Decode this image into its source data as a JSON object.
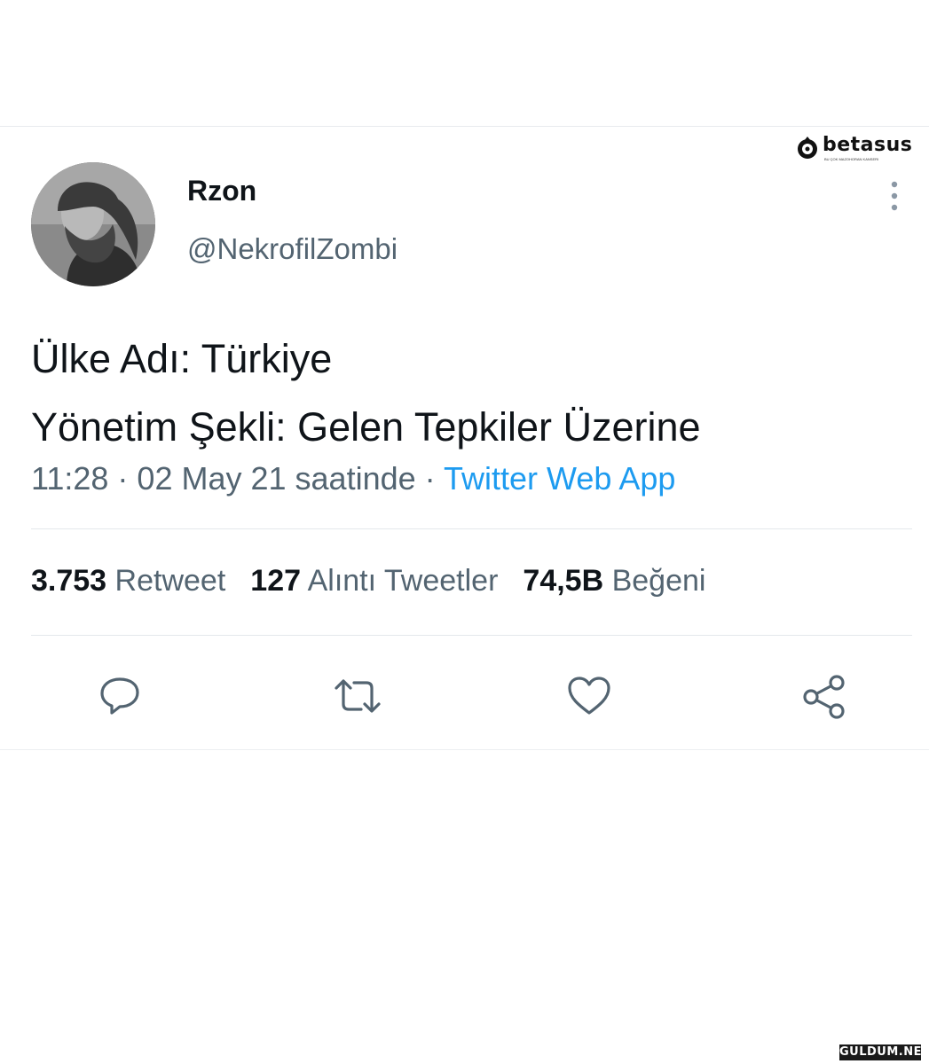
{
  "watermarks": {
    "top": "betasus",
    "top_sub": "BU ÇOK MAZOHORAN KANSERI",
    "bottom": "GULDUM.NET"
  },
  "user": {
    "display_name": "Rzon",
    "handle": "@NekrofilZombi"
  },
  "tweet": {
    "lines": [
      "Ülke Adı: Türkiye",
      "Yönetim Şekli: Gelen Tepkiler Üzerine"
    ]
  },
  "meta": {
    "time": "11:28",
    "date": "02 May 21 saatinde",
    "separator": " · ",
    "source": "Twitter Web App"
  },
  "stats": [
    {
      "number": "3.753",
      "label": "Retweet"
    },
    {
      "number": "127",
      "label": "Alıntı Tweetler"
    },
    {
      "number": "74,5B",
      "label": "Beğeni"
    }
  ],
  "icons": {
    "more": "more-vertical-icon",
    "reply": "reply-icon",
    "retweet": "retweet-icon",
    "like": "heart-icon",
    "share": "share-icon"
  },
  "colors": {
    "text": "#0f1419",
    "secondary": "#536471",
    "link": "#1d9bf0",
    "divider": "#e4e8eb"
  }
}
